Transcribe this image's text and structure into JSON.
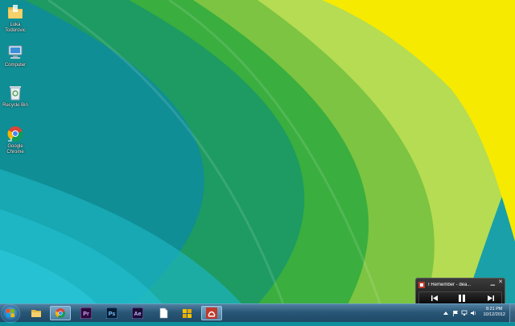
{
  "desktop": {
    "icons": [
      {
        "name": "folder-icon",
        "label": "Luka\nTodorovic"
      },
      {
        "name": "computer-icon",
        "label": "Computer"
      },
      {
        "name": "recycle-bin-icon",
        "label": "Recycle Bin"
      },
      {
        "name": "chrome-icon",
        "label": "Google\nChrome"
      }
    ]
  },
  "taskbar": {
    "start": "windows-start-icon",
    "pinned": [
      {
        "name": "explorer-icon"
      },
      {
        "name": "chrome-icon",
        "active": true
      },
      {
        "name": "premiere-icon",
        "text": "Pr"
      },
      {
        "name": "photoshop-icon",
        "text": "Ps"
      },
      {
        "name": "after-effects-icon",
        "text": "Ae"
      },
      {
        "name": "notepad-icon"
      },
      {
        "name": "yellow-folder-icon"
      },
      {
        "name": "media-player-icon",
        "active": true
      }
    ],
    "clock": {
      "time": "8:21 PM",
      "date": "10/12/2012"
    }
  },
  "media_widget": {
    "title": "I Remember - dea..."
  },
  "colors": {
    "taskbar": "#2a5777",
    "wallpaper_yellow": "#f6ea00",
    "wallpaper_green": "#3fae3a",
    "wallpaper_teal": "#0e8f9c"
  }
}
